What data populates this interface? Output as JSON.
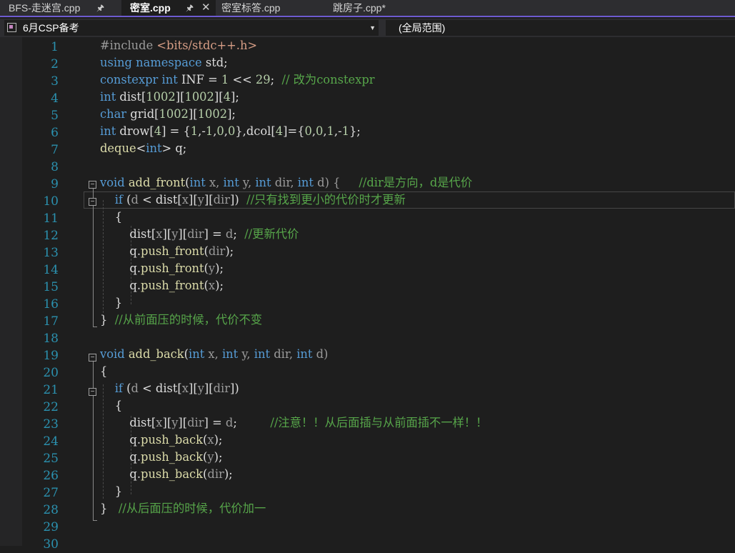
{
  "tabs": [
    {
      "label": "BFS-走迷宫.cpp",
      "icon": "pin-icon"
    },
    {
      "label": "密室.cpp",
      "icon": "pin-icon",
      "active": true
    },
    {
      "label": "密室标答.cpp"
    },
    {
      "label": "跳房子.cpp*"
    }
  ],
  "navbar": {
    "project": "6月CSP备考",
    "scope": "(全局范围)"
  },
  "editor": {
    "lines": [
      {
        "n": "1"
      },
      {
        "n": "2"
      },
      {
        "n": "3"
      },
      {
        "n": "4"
      },
      {
        "n": "5"
      },
      {
        "n": "6"
      },
      {
        "n": "7"
      },
      {
        "n": "8"
      },
      {
        "n": "9"
      },
      {
        "n": "10"
      },
      {
        "n": "11"
      },
      {
        "n": "12"
      },
      {
        "n": "13"
      },
      {
        "n": "14"
      },
      {
        "n": "15"
      },
      {
        "n": "16"
      },
      {
        "n": "17"
      },
      {
        "n": "18"
      },
      {
        "n": "19"
      },
      {
        "n": "20"
      },
      {
        "n": "21"
      },
      {
        "n": "22"
      },
      {
        "n": "23"
      },
      {
        "n": "24"
      },
      {
        "n": "25"
      },
      {
        "n": "26"
      },
      {
        "n": "27"
      },
      {
        "n": "28"
      },
      {
        "n": "29"
      },
      {
        "n": "30"
      }
    ],
    "code": {
      "l1": {
        "a": "#include ",
        "b": "<bits/stdc++.h>"
      },
      "l2": {
        "a": "using",
        "b": " ",
        "c": "namespace",
        "d": " std;"
      },
      "l3": {
        "a": "constexpr",
        "b": " ",
        "c": "int",
        "d": " INF = ",
        "e": "1",
        "f": " << ",
        "g": "29",
        "h": ";  ",
        "i": "// 改为constexpr"
      },
      "l4": {
        "a": "int",
        "b": " dist[",
        "c": "1002",
        "d": "][",
        "e": "1002",
        "f": "][",
        "g": "4",
        "h": "];"
      },
      "l5": {
        "a": "char",
        "b": " grid[",
        "c": "1002",
        "d": "][",
        "e": "1002",
        "f": "];"
      },
      "l6": {
        "a": "int",
        "b": " drow[",
        "c": "4",
        "d": "] = {",
        "e": "1",
        "f": ",-",
        "g": "1",
        "h": ",",
        "i": "0",
        "j": ",",
        "k": "0",
        "l": "},dcol[",
        "m": "4",
        "n": "]={",
        "o": "0",
        "p": ",",
        "q": "0",
        "r": ",",
        "s": "1",
        "t": ",-",
        "u": "1",
        "v": "};"
      },
      "l7": {
        "a": "deque",
        "b": "<",
        "c": "int",
        "d": "> q;"
      },
      "l9": {
        "a": "void",
        "b": " ",
        "c": "add_front",
        "d": "(",
        "e": "int",
        "f": " x, ",
        "g": "int",
        "h": " y, ",
        "i": "int",
        "j": " dir, ",
        "k": "int",
        "l": " d) {     ",
        "m": "//dir是方向，d是代价"
      },
      "l10": {
        "a": "    ",
        "b": "if",
        "c": " (",
        "d": "d",
        "e": " < dist[",
        "f": "x",
        "g": "][",
        "h": "y",
        "i": "][",
        "j": "dir",
        "k": "])  ",
        "l": "//只有找到更小的代价时才更新"
      },
      "l11": {
        "a": "    {"
      },
      "l12": {
        "a": "        dist[",
        "b": "x",
        "c": "][",
        "d": "y",
        "e": "][",
        "f": "dir",
        "g": "] = ",
        "h": "d",
        "i": ";  ",
        "j": "//更新代价"
      },
      "l13": {
        "a": "        q.",
        "b": "push_front",
        "c": "(",
        "d": "dir",
        "e": ");"
      },
      "l14": {
        "a": "        q.",
        "b": "push_front",
        "c": "(",
        "d": "y",
        "e": ");"
      },
      "l15": {
        "a": "        q.",
        "b": "push_front",
        "c": "(",
        "d": "x",
        "e": ");"
      },
      "l16": {
        "a": "    }"
      },
      "l17": {
        "a": "}  ",
        "b": "//从前面压的时候，代价不变"
      },
      "l19": {
        "a": "void",
        "b": " ",
        "c": "add_back",
        "d": "(",
        "e": "int",
        "f": " x, ",
        "g": "int",
        "h": " y, ",
        "i": "int",
        "j": " dir, ",
        "k": "int",
        "l": " d)"
      },
      "l20": {
        "a": "{"
      },
      "l21": {
        "a": "    ",
        "b": "if",
        "c": " (",
        "d": "d",
        "e": " < dist[",
        "f": "x",
        "g": "][",
        "h": "y",
        "i": "][",
        "j": "dir",
        "k": "])"
      },
      "l22": {
        "a": "    {"
      },
      "l23": {
        "a": "        dist[",
        "b": "x",
        "c": "][",
        "d": "y",
        "e": "][",
        "f": "dir",
        "g": "] = ",
        "h": "d",
        "i": ";         ",
        "j": "//注意！！从后面插与从前面插不一样！！"
      },
      "l24": {
        "a": "        q.",
        "b": "push_back",
        "c": "(",
        "d": "x",
        "e": ");"
      },
      "l25": {
        "a": "        q.",
        "b": "push_back",
        "c": "(",
        "d": "y",
        "e": ");"
      },
      "l26": {
        "a": "        q.",
        "b": "push_back",
        "c": "(",
        "d": "dir",
        "e": ");"
      },
      "l27": {
        "a": "    }"
      },
      "l28": {
        "a": "}   ",
        "b": "//从后面压的时候，代价加一"
      }
    }
  },
  "colors": {
    "keyword": "#569cd6",
    "function": "#dcdcaa",
    "number": "#b5cea8",
    "string": "#d69d85",
    "comment": "#57a64a",
    "line_number": "#2b91af",
    "accent": "#6d5bd0"
  }
}
